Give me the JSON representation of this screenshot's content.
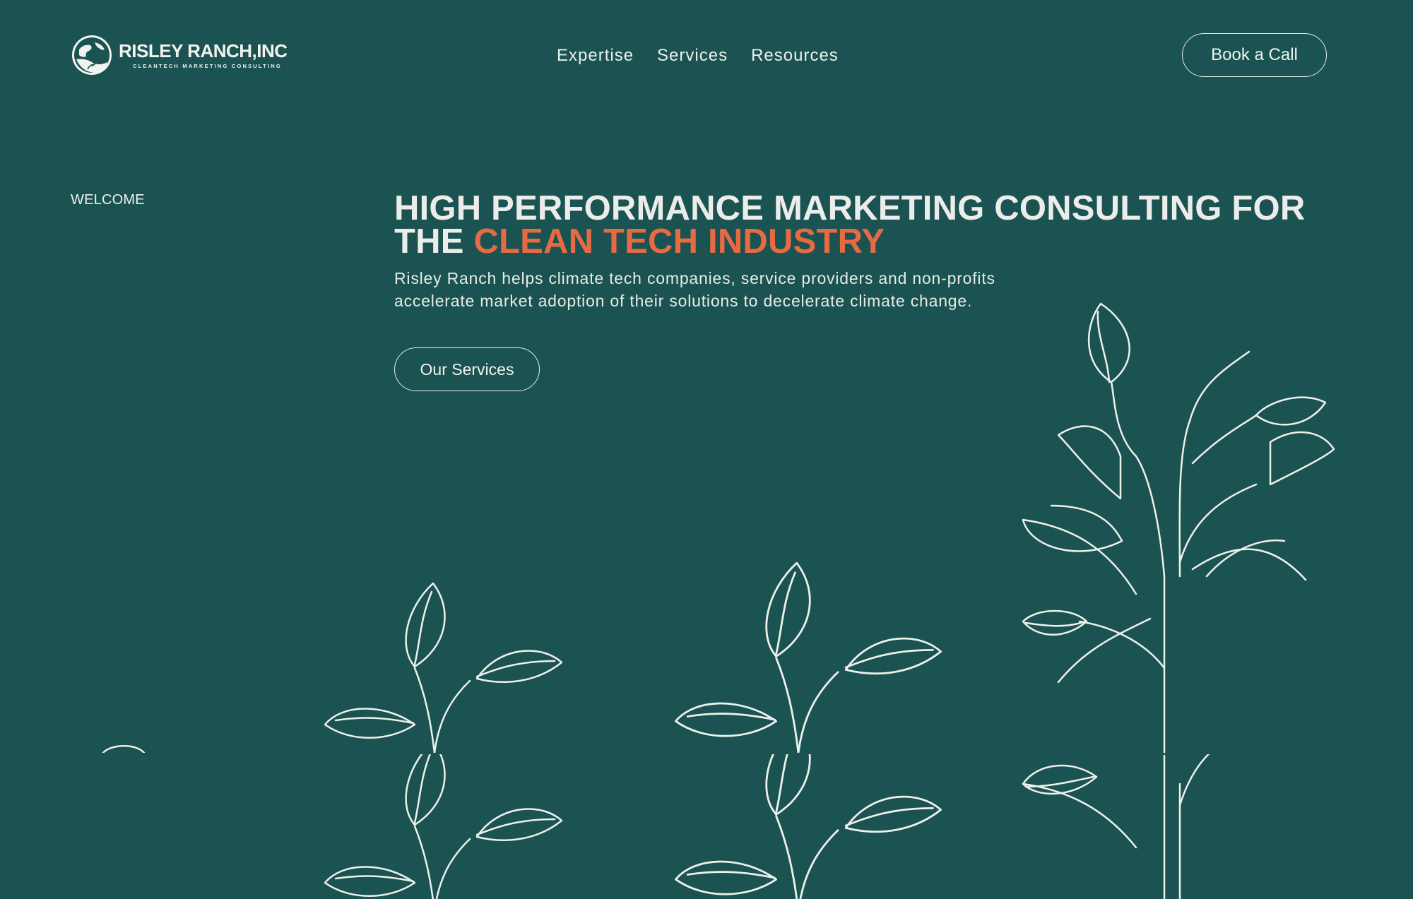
{
  "brand": {
    "name": "RISLEY RANCH,INC",
    "tagline": "CLEANTECH MARKETING CONSULTING"
  },
  "nav": {
    "items": [
      "Expertise",
      "Services",
      "Resources"
    ]
  },
  "header": {
    "cta_label": "Book a Call"
  },
  "hero": {
    "eyebrow": "WELCOME",
    "headline_line1": "HIGH PERFORMANCE MARKETING CONSULTING FOR",
    "headline_line2_prefix": "THE",
    "headline_line2_accent": "CLEAN TECH INDUSTRY",
    "lead_line1": "Risley Ranch helps climate tech companies, service providers and non-profits",
    "lead_line2": "accelerate market adoption of their solutions to decelerate climate change.",
    "button_label": "Our Services"
  },
  "colors": {
    "background": "#1a5351",
    "accent": "#e86a43",
    "text": "#eef0ec",
    "line": "#e8ece6"
  },
  "illustration": {
    "icon": "leafy-sprout-line-art"
  }
}
